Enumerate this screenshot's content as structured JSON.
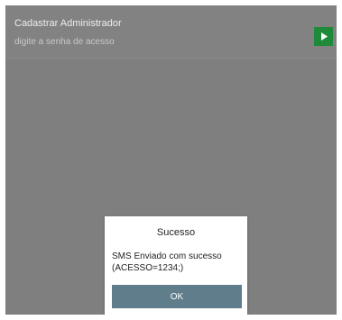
{
  "header": {
    "title": "Cadastrar Administrador",
    "password_placeholder": "digite a senha de acesso",
    "go_button_icon": "play-icon"
  },
  "dialog": {
    "title": "Sucesso",
    "message_line1": "SMS Enviado com sucesso",
    "message_line2": "(ACESSO=1234;)",
    "ok_label": "OK"
  },
  "colors": {
    "overlay": "#7f7f7f",
    "go_button": "#1f8a3a",
    "ok_button": "#607d8b"
  }
}
